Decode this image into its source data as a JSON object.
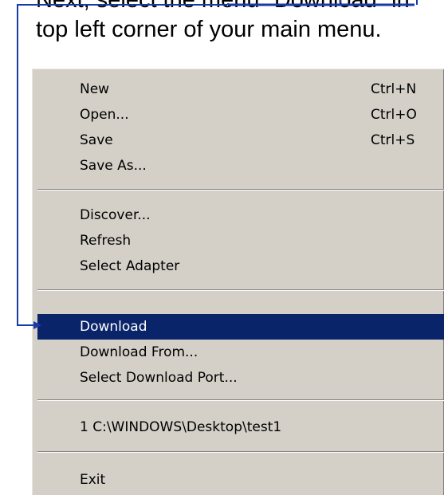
{
  "instruction": {
    "line1": "Next, select the menu \"Download\" in",
    "line2": "top left corner of your main menu."
  },
  "menu": {
    "items": [
      {
        "label": "New",
        "shortcut": "Ctrl+N"
      },
      {
        "label": "Open...",
        "shortcut": "Ctrl+O"
      },
      {
        "label": "Save",
        "shortcut": "Ctrl+S"
      },
      {
        "label": "Save As...",
        "shortcut": ""
      },
      {
        "label": "Discover...",
        "shortcut": ""
      },
      {
        "label": "Refresh",
        "shortcut": ""
      },
      {
        "label": "Select Adapter",
        "shortcut": ""
      },
      {
        "label": "Download",
        "shortcut": ""
      },
      {
        "label": "Download From...",
        "shortcut": ""
      },
      {
        "label": "Select Download Port...",
        "shortcut": ""
      },
      {
        "label": "1 C:\\WINDOWS\\Desktop\\test1",
        "shortcut": ""
      },
      {
        "label": "Exit",
        "shortcut": ""
      }
    ],
    "highlighted_item": "Download"
  },
  "colors": {
    "menu_background": "#d4d0c8",
    "highlight_background": "#0a246a",
    "highlight_text": "#ffffff",
    "callout_line": "#1a3aa6"
  }
}
